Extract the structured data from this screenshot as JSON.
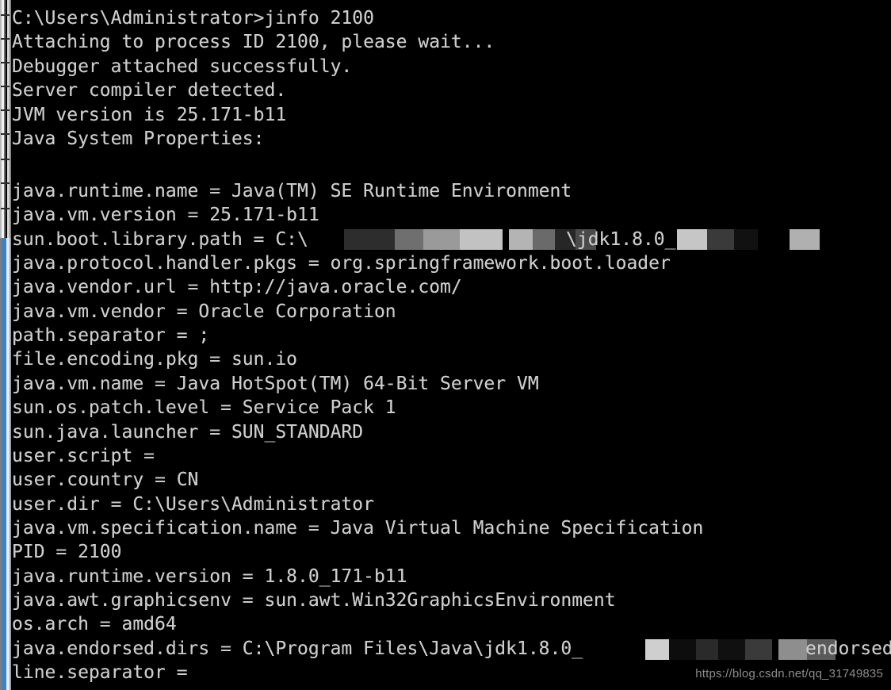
{
  "window": {
    "type": "windows-command-prompt",
    "background_color": "#000000",
    "text_color": "#cccccc"
  },
  "background_windows": {
    "top_sliver_color": "#d4d4d4",
    "bottom_sliver_color": "#3c82c4"
  },
  "console": {
    "prompt_line": "C:\\Users\\Administrator>jinfo 2100",
    "lines": [
      {
        "text": "C:\\Users\\Administrator>jinfo 2100"
      },
      {
        "text": "Attaching to process ID 2100, please wait..."
      },
      {
        "text": "Debugger attached successfully."
      },
      {
        "text": "Server compiler detected."
      },
      {
        "text": "JVM version is 25.171-b11"
      },
      {
        "text": "Java System Properties:"
      },
      {
        "text": ""
      },
      {
        "text": "java.runtime.name = Java(TM) SE Runtime Environment"
      },
      {
        "text": "java.vm.version = 25.171-b11"
      },
      {
        "text": "sun.boot.library.path = C:\\",
        "redacted": "boot-library-path"
      },
      {
        "text": "java.protocol.handler.pkgs = org.springframework.boot.loader"
      },
      {
        "text": "java.vendor.url = http://java.oracle.com/"
      },
      {
        "text": "java.vm.vendor = Oracle Corporation"
      },
      {
        "text": "path.separator = ;"
      },
      {
        "text": "file.encoding.pkg = sun.io"
      },
      {
        "text": "java.vm.name = Java HotSpot(TM) 64-Bit Server VM"
      },
      {
        "text": "sun.os.patch.level = Service Pack 1"
      },
      {
        "text": "sun.java.launcher = SUN_STANDARD"
      },
      {
        "text": "user.script ="
      },
      {
        "text": "user.country = CN"
      },
      {
        "text": "user.dir = C:\\Users\\Administrator"
      },
      {
        "text": "java.vm.specification.name = Java Virtual Machine Specification"
      },
      {
        "text": "PID = 2100"
      },
      {
        "text": "java.runtime.version = 1.8.0_171-b11"
      },
      {
        "text": "java.awt.graphicsenv = sun.awt.Win32GraphicsEnvironment"
      },
      {
        "text": "os.arch = amd64"
      },
      {
        "text": "java.endorsed.dirs = C:\\Program Files\\Java\\jdk1.8.0_",
        "redacted": "endorsed-dirs"
      },
      {
        "text": "line.separator ="
      }
    ],
    "redactions": {
      "boot-library-path": {
        "partial_visible_text": "\\jdk1.8.0_171\\",
        "description": "pixelated mosaic hiding part of the JDK install path"
      },
      "endorsed-dirs": {
        "partial_visible_text": "endorsed",
        "description": "pixelated mosaic hiding part of the endorsed dirs path"
      }
    }
  },
  "watermark": {
    "text": "https://blog.csdn.net/qq_31749835"
  }
}
